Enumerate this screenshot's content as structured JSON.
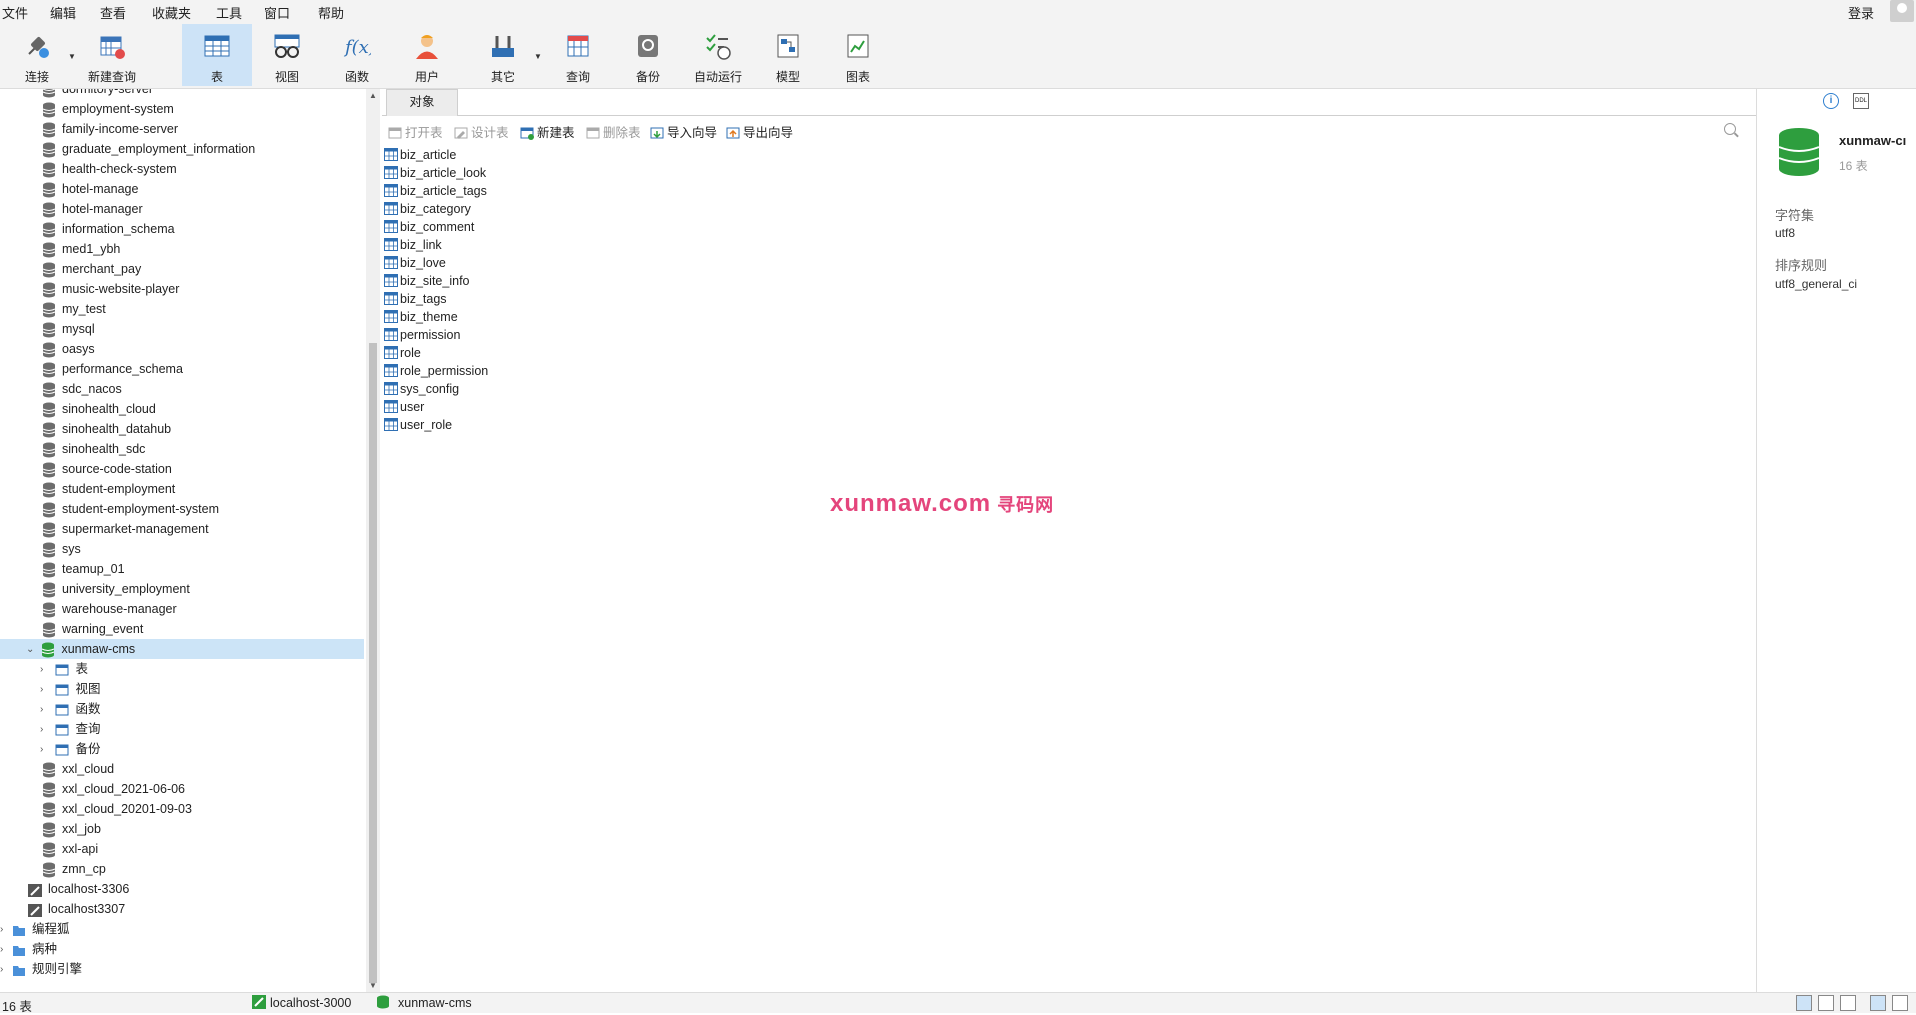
{
  "menu": [
    "文件",
    "编辑",
    "查看",
    "收藏夹",
    "工具",
    "窗口",
    "帮助"
  ],
  "login_label": "登录",
  "toolbar": {
    "connect": "连接",
    "new_query": "新建查询",
    "table": "表",
    "view": "视图",
    "function": "函数",
    "user": "用户",
    "other": "其它",
    "query": "查询",
    "backup": "备份",
    "auto_run": "自动运行",
    "model": "模型",
    "chart": "图表"
  },
  "sidebar": {
    "databases_before": [
      "dormitory-server",
      "employment-system",
      "family-income-server",
      "graduate_employment_information",
      "health-check-system",
      "hotel-manage",
      "hotel-manager",
      "information_schema",
      "med1_ybh",
      "merchant_pay",
      "music-website-player",
      "my_test",
      "mysql",
      "oasys",
      "performance_schema",
      "sdc_nacos",
      "sinohealth_cloud",
      "sinohealth_datahub",
      "sinohealth_sdc",
      "source-code-station",
      "student-employment",
      "student-employment-system",
      "supermarket-management",
      "sys",
      "teamup_01",
      "university_employment",
      "warehouse-manager",
      "warning_event"
    ],
    "selected_db": "xunmaw-cms",
    "children": [
      "表",
      "视图",
      "函数",
      "查询",
      "备份"
    ],
    "databases_after": [
      "xxl_cloud",
      "xxl_cloud_2021-06-06",
      "xxl_cloud_20201-09-03",
      "xxl_job",
      "xxl-api",
      "zmn_cp"
    ],
    "connections": [
      "localhost-3306",
      "localhost3307"
    ],
    "groups": [
      "编程狐",
      "病种",
      "规则引擎"
    ]
  },
  "objects": {
    "tab": "对象",
    "toolbar": {
      "open": "打开表",
      "design": "设计表",
      "new": "新建表",
      "delete": "删除表",
      "import": "导入向导",
      "export": "导出向导"
    },
    "tables": [
      "biz_article",
      "biz_article_look",
      "biz_article_tags",
      "biz_category",
      "biz_comment",
      "biz_link",
      "biz_love",
      "biz_site_info",
      "biz_tags",
      "biz_theme",
      "permission",
      "role",
      "role_permission",
      "sys_config",
      "user",
      "user_role"
    ]
  },
  "watermark": {
    "text": "xunmaw.com",
    "suffix": "寻码网"
  },
  "right_panel": {
    "db_name": "xunmaw-cı",
    "count": "16 表",
    "charset_label": "字符集",
    "charset": "utf8",
    "collation_label": "排序规则",
    "collation": "utf8_general_ci"
  },
  "status": {
    "count": "16 表",
    "connection": "localhost-3000",
    "database": "xunmaw-cms"
  },
  "colors": {
    "accent": "#cde3f7",
    "db_green": "#2e9e3e",
    "watermark": "#e4457c"
  }
}
